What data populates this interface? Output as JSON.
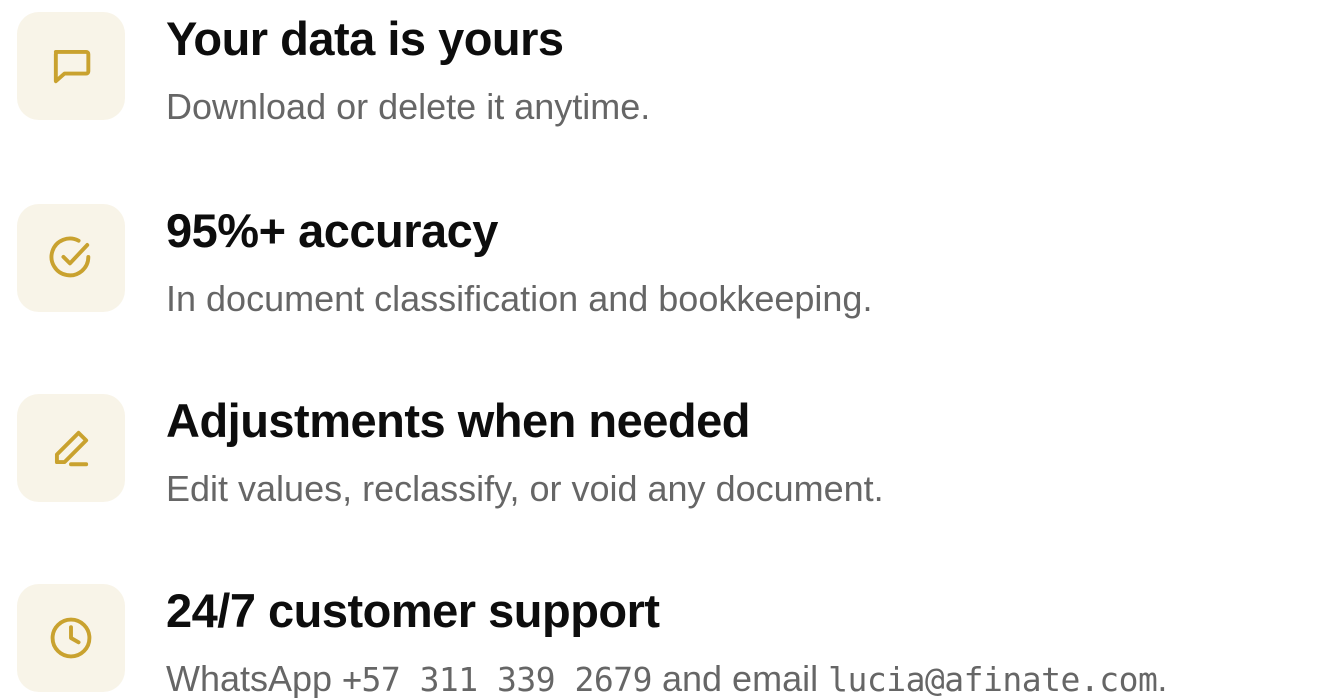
{
  "accent_color": "#c9a22f",
  "tile_color": "#f8f4e8",
  "features": [
    {
      "icon": "message-square-icon",
      "title": "Your data is yours",
      "description": "Download or delete it anytime."
    },
    {
      "icon": "check-circle-icon",
      "title": "95%+ accuracy",
      "description": "In document classification and bookkeeping."
    },
    {
      "icon": "pencil-line-icon",
      "title": "Adjustments when needed",
      "description": "Edit values, reclassify, or void any document."
    },
    {
      "icon": "clock-icon",
      "title": "24/7 customer support",
      "description_prefix": "WhatsApp ",
      "phone": "+57 311 339 2679",
      "description_middle": " and email ",
      "email": "lucia@afinate.com",
      "description_suffix": "."
    }
  ]
}
